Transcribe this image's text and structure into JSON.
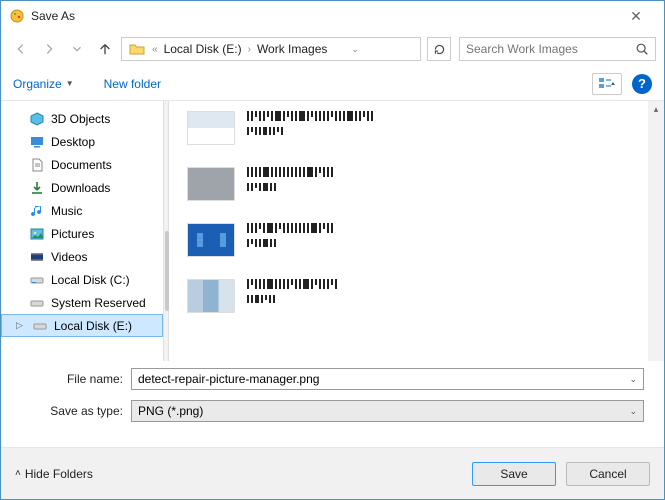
{
  "window": {
    "title": "Save As"
  },
  "nav": {
    "crumb1": "Local Disk (E:)",
    "crumb2": "Work Images",
    "search_placeholder": "Search Work Images"
  },
  "toolbar": {
    "organize": "Organize",
    "newfolder": "New folder"
  },
  "tree": {
    "items": [
      {
        "label": "3D Objects"
      },
      {
        "label": "Desktop"
      },
      {
        "label": "Documents"
      },
      {
        "label": "Downloads"
      },
      {
        "label": "Music"
      },
      {
        "label": "Pictures"
      },
      {
        "label": "Videos"
      },
      {
        "label": "Local Disk (C:)"
      },
      {
        "label": "System Reserved"
      },
      {
        "label": "Local Disk (E:)"
      }
    ]
  },
  "form": {
    "filename_label": "File name:",
    "filename_value": "detect-repair-picture-manager.png",
    "type_label": "Save as type:",
    "type_value": "PNG (*.png)"
  },
  "bottom": {
    "hidefolders": "Hide Folders",
    "save": "Save",
    "cancel": "Cancel"
  }
}
